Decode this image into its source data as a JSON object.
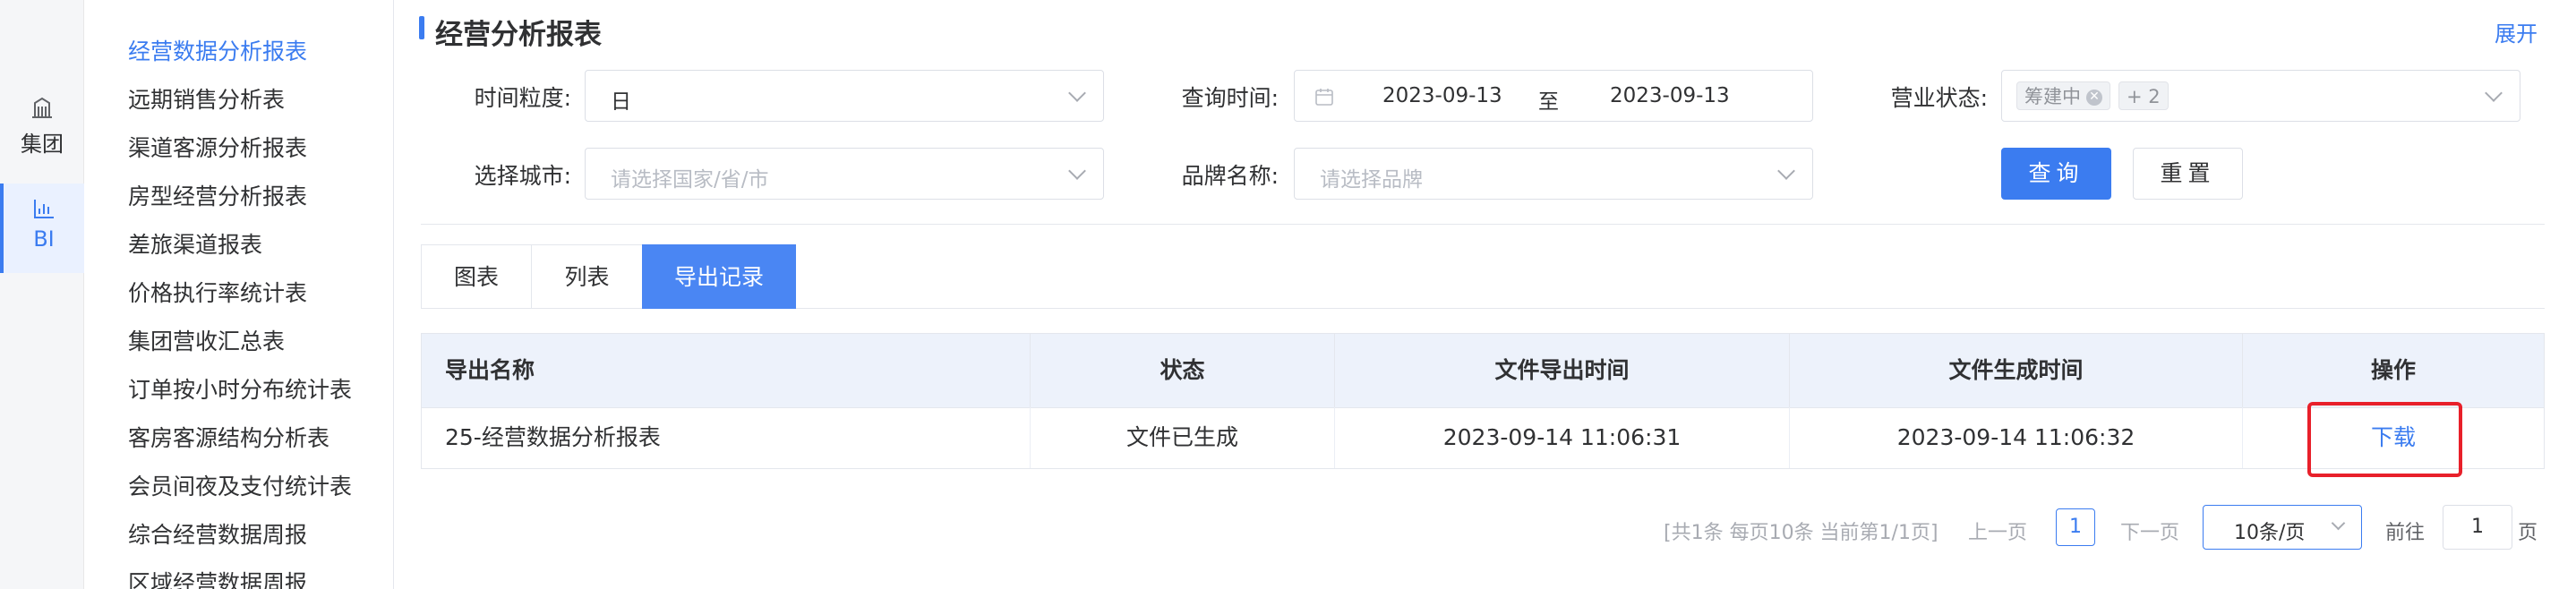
{
  "rail": {
    "items": [
      {
        "label": "集团",
        "icon": "building-icon"
      },
      {
        "label": "BI",
        "icon": "bar-chart-icon"
      }
    ]
  },
  "sidebar": {
    "items": [
      {
        "label": "经营数据分析报表",
        "active": true
      },
      {
        "label": "远期销售分析表"
      },
      {
        "label": "渠道客源分析报表"
      },
      {
        "label": "房型经营分析报表"
      },
      {
        "label": "差旅渠道报表"
      },
      {
        "label": "价格执行率统计表"
      },
      {
        "label": "集团营收汇总表"
      },
      {
        "label": "订单按小时分布统计表"
      },
      {
        "label": "客房客源结构分析表"
      },
      {
        "label": "会员间夜及支付统计表"
      },
      {
        "label": "综合经营数据周报"
      },
      {
        "label": "区域经营数据周报"
      }
    ]
  },
  "header": {
    "title": "经营分析报表",
    "expand_label": "展开"
  },
  "filters": {
    "granularity": {
      "label": "时间粒度:",
      "value": "日"
    },
    "query_time": {
      "label": "查询时间:",
      "start": "2023-09-13",
      "separator": "至",
      "end": "2023-09-13"
    },
    "business_status": {
      "label": "营业状态:",
      "tag": "筹建中",
      "more": "+ 2"
    },
    "city": {
      "label": "选择城市:",
      "placeholder": "请选择国家/省/市"
    },
    "brand": {
      "label": "品牌名称:",
      "placeholder": "请选择品牌"
    },
    "query_button": "查询",
    "reset_button": "重置"
  },
  "tabs": [
    {
      "label": "图表"
    },
    {
      "label": "列表"
    },
    {
      "label": "导出记录",
      "active": true
    }
  ],
  "table": {
    "columns": [
      "导出名称",
      "状态",
      "文件导出时间",
      "文件生成时间",
      "操作"
    ],
    "rows": [
      {
        "name": "25-经营数据分析报表",
        "status": "文件已生成",
        "export_time": "2023-09-14 11:06:31",
        "generate_time": "2023-09-14 11:06:32",
        "action": "下载"
      }
    ]
  },
  "pagination": {
    "summary": "[共1条 每页10条 当前第1/1页]",
    "prev": "上一页",
    "current_page": "1",
    "next": "下一页",
    "page_size": "10条/页",
    "goto_label": "前往",
    "goto_value": "1",
    "goto_suffix": "页"
  },
  "colors": {
    "accent": "#3b7cf0",
    "highlight": "#e8202a"
  }
}
